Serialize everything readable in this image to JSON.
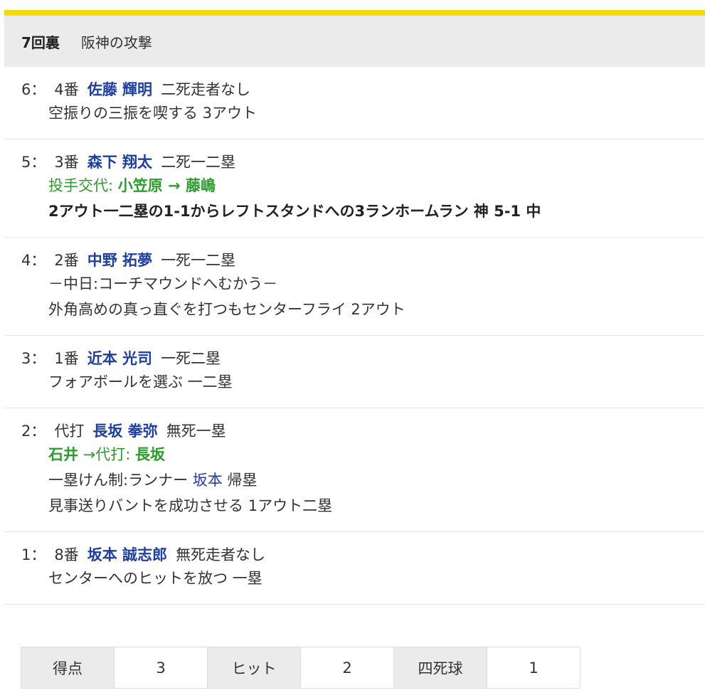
{
  "colors": {
    "accent_bar": "#f5d90a",
    "player_link": "#1f3f9e",
    "substitution": "#2e9b2e"
  },
  "header": {
    "inning": "7回裏",
    "team": "阪神の攻撃"
  },
  "plays": [
    {
      "num": "6：",
      "order": "4番",
      "player": "佐藤 輝明",
      "situation": "二死走者なし",
      "lines": [
        {
          "text": "空振りの三振を喫する 3アウト"
        }
      ]
    },
    {
      "num": "5：",
      "order": "3番",
      "player": "森下 翔太",
      "situation": "二死一二塁",
      "substitution": {
        "prefix": "投手交代: ",
        "from": "小笠原",
        "arrow": " → ",
        "to": "藤嶋"
      },
      "lines": [
        {
          "text": "2アウト一二塁の1-1からレフトスタンドへの3ランホームラン 神 5-1 中",
          "bold": true
        }
      ]
    },
    {
      "num": "4：",
      "order": "2番",
      "player": "中野 拓夢",
      "situation": "一死一二塁",
      "lines": [
        {
          "text": "－中日:コーチマウンドへむかう－"
        },
        {
          "text": "外角高めの真っ直ぐを打つもセンターフライ 2アウト"
        }
      ]
    },
    {
      "num": "3：",
      "order": "1番",
      "player": "近本 光司",
      "situation": "一死二塁",
      "lines": [
        {
          "text": "フォアボールを選ぶ 一二塁"
        }
      ]
    },
    {
      "num": "2：",
      "order": "代打",
      "player": "長坂 拳弥",
      "situation": "無死一塁",
      "substitution2": {
        "from": "石井",
        "arrow": " →",
        "prefix": "代打: ",
        "to": "長坂"
      },
      "runner_line": {
        "before": "一塁けん制:ランナー ",
        "runner": "坂本",
        "after": " 帰塁"
      },
      "lines": [
        {
          "text": "見事送りバントを成功させる 1アウト二塁"
        }
      ]
    },
    {
      "num": "1：",
      "order": "8番",
      "player": "坂本 誠志郎",
      "situation": "無死走者なし",
      "lines": [
        {
          "text": "センターへのヒットを放つ 一塁"
        }
      ]
    }
  ],
  "stats": [
    {
      "label": "得点",
      "value": "3"
    },
    {
      "label": "ヒット",
      "value": "2"
    },
    {
      "label": "四死球",
      "value": "1"
    }
  ]
}
